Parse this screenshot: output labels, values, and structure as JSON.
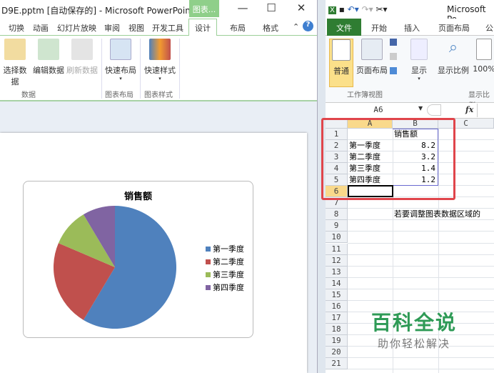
{
  "ppt": {
    "title": "D9E.pptm [自动保存的] - Microsoft PowerPoint",
    "context_tab": "图表...",
    "window_controls": [
      "—",
      "☐",
      "✕"
    ],
    "tabs": [
      "切换",
      "动画",
      "幻灯片放映",
      "审阅",
      "视图",
      "开发工具",
      "设计",
      "布局",
      "格式"
    ],
    "active_tab": "设计",
    "ribbon": {
      "buttons": [
        "选择数据",
        "编辑数据",
        "刷新数据",
        "快速布局",
        "快速样式"
      ],
      "groups": [
        "数据",
        "图表布局",
        "图表样式"
      ]
    }
  },
  "chart_data": {
    "type": "pie",
    "title": "销售额",
    "categories": [
      "第一季度",
      "第二季度",
      "第三季度",
      "第四季度"
    ],
    "values": [
      8.2,
      3.2,
      1.4,
      1.2
    ],
    "colors": [
      "#4f81bd",
      "#c0504d",
      "#9bbb59",
      "#8064a2"
    ],
    "legend": "right"
  },
  "excel": {
    "title": "Microsoft Po",
    "tabs": [
      "文件",
      "开始",
      "插入",
      "页面布局",
      "公"
    ],
    "ribbon": {
      "buttons": [
        "普通",
        "页面布局",
        "显示",
        "显示比例",
        "100%"
      ],
      "groups": [
        "工作簿视图",
        "显示比例"
      ]
    },
    "name_box": "A6",
    "fx": "fx",
    "columns": [
      "A",
      "B",
      "C"
    ],
    "rows": [
      "1",
      "2",
      "3",
      "4",
      "5",
      "6",
      "7",
      "8",
      "9",
      "10",
      "11",
      "12",
      "13",
      "14",
      "15",
      "16",
      "17",
      "18",
      "19",
      "20",
      "21"
    ],
    "cells": {
      "B1": "销售额",
      "A2": "第一季度",
      "B2": "8.2",
      "A3": "第二季度",
      "B3": "3.2",
      "A4": "第三季度",
      "B4": "1.4",
      "A5": "第四季度",
      "B5": "1.2",
      "B8": "若要调整图表数据区域的"
    }
  },
  "watermark": {
    "title": "百科全说",
    "subtitle": "助你轻松解决"
  }
}
